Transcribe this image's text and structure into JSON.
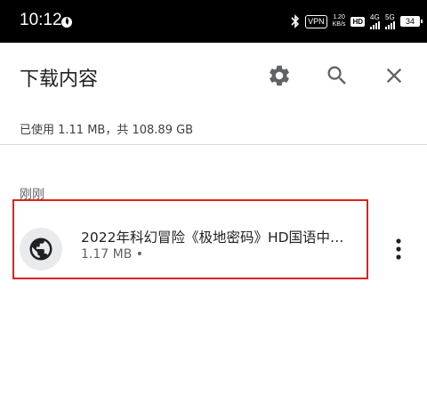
{
  "status_bar": {
    "time": "10:12",
    "vpn": "VPN",
    "speed_value": "1.20",
    "speed_unit": "KB/s",
    "hd": "HD",
    "net1": "4G",
    "net2": "5G",
    "battery": "34"
  },
  "header": {
    "title": "下载内容",
    "icons": [
      "gear-icon",
      "search-icon",
      "close-icon"
    ]
  },
  "storage_text": "已使用 1.11 MB，共 108.89 GB",
  "section_label": "刚刚",
  "downloads": [
    {
      "name": "2022年科幻冒险《极地密码》HD国语中…",
      "meta": "1.17 MB •",
      "icon": "globe-icon"
    }
  ],
  "colors": {
    "highlight": "#e0201c",
    "icon": "#5f6368",
    "text": "#202124"
  }
}
